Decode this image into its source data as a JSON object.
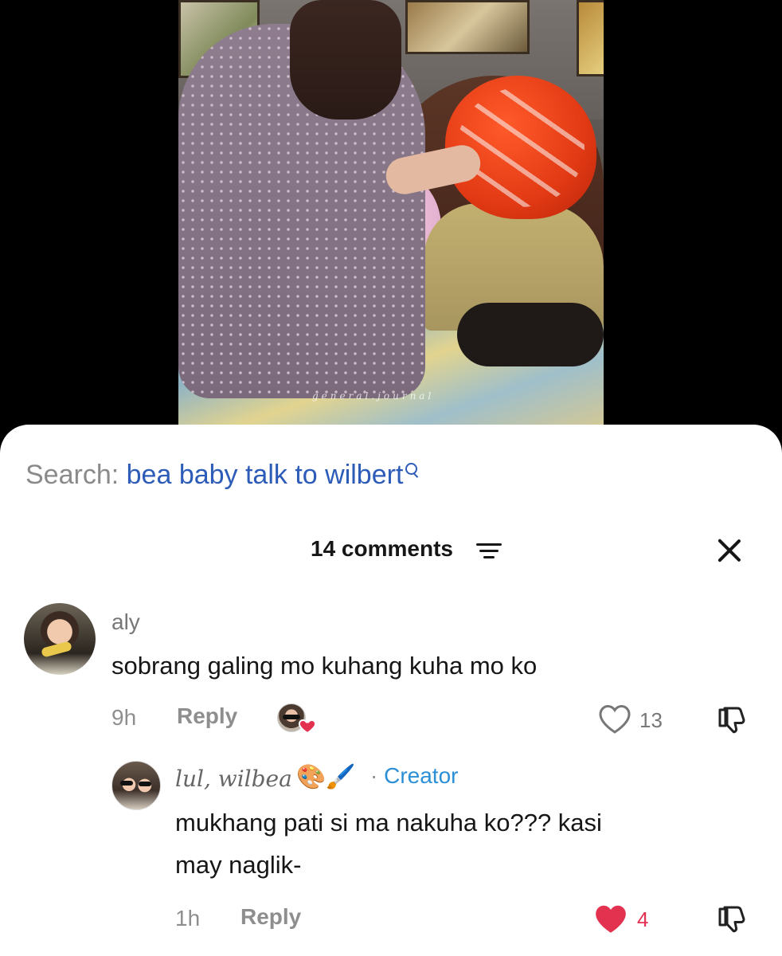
{
  "video": {
    "watermark": "general.journal"
  },
  "search": {
    "prefix": "Search:",
    "query": "bea baby talk to wilbert"
  },
  "comments_header": {
    "title": "14 comments"
  },
  "comments": [
    {
      "username": "aly",
      "text": "sobrang galing mo kuhang kuha mo ko",
      "time": "9h",
      "reply_label": "Reply",
      "liked_by_creator": true,
      "likes": "13",
      "liked": false
    }
  ],
  "replies": [
    {
      "username": "lul, wilbea",
      "username_emoji": "🎨🖌️",
      "creator_label": "Creator",
      "separator": "·",
      "text_line1": "mukhang pati si ma nakuha ko??? kasi",
      "text_line2": "may naglik-",
      "time": "1h",
      "reply_label": "Reply",
      "likes": "4",
      "liked": true
    }
  ],
  "colors": {
    "search_link": "#2c5bb8",
    "creator_tag": "#2c8fd6",
    "like_red": "#e33150"
  }
}
